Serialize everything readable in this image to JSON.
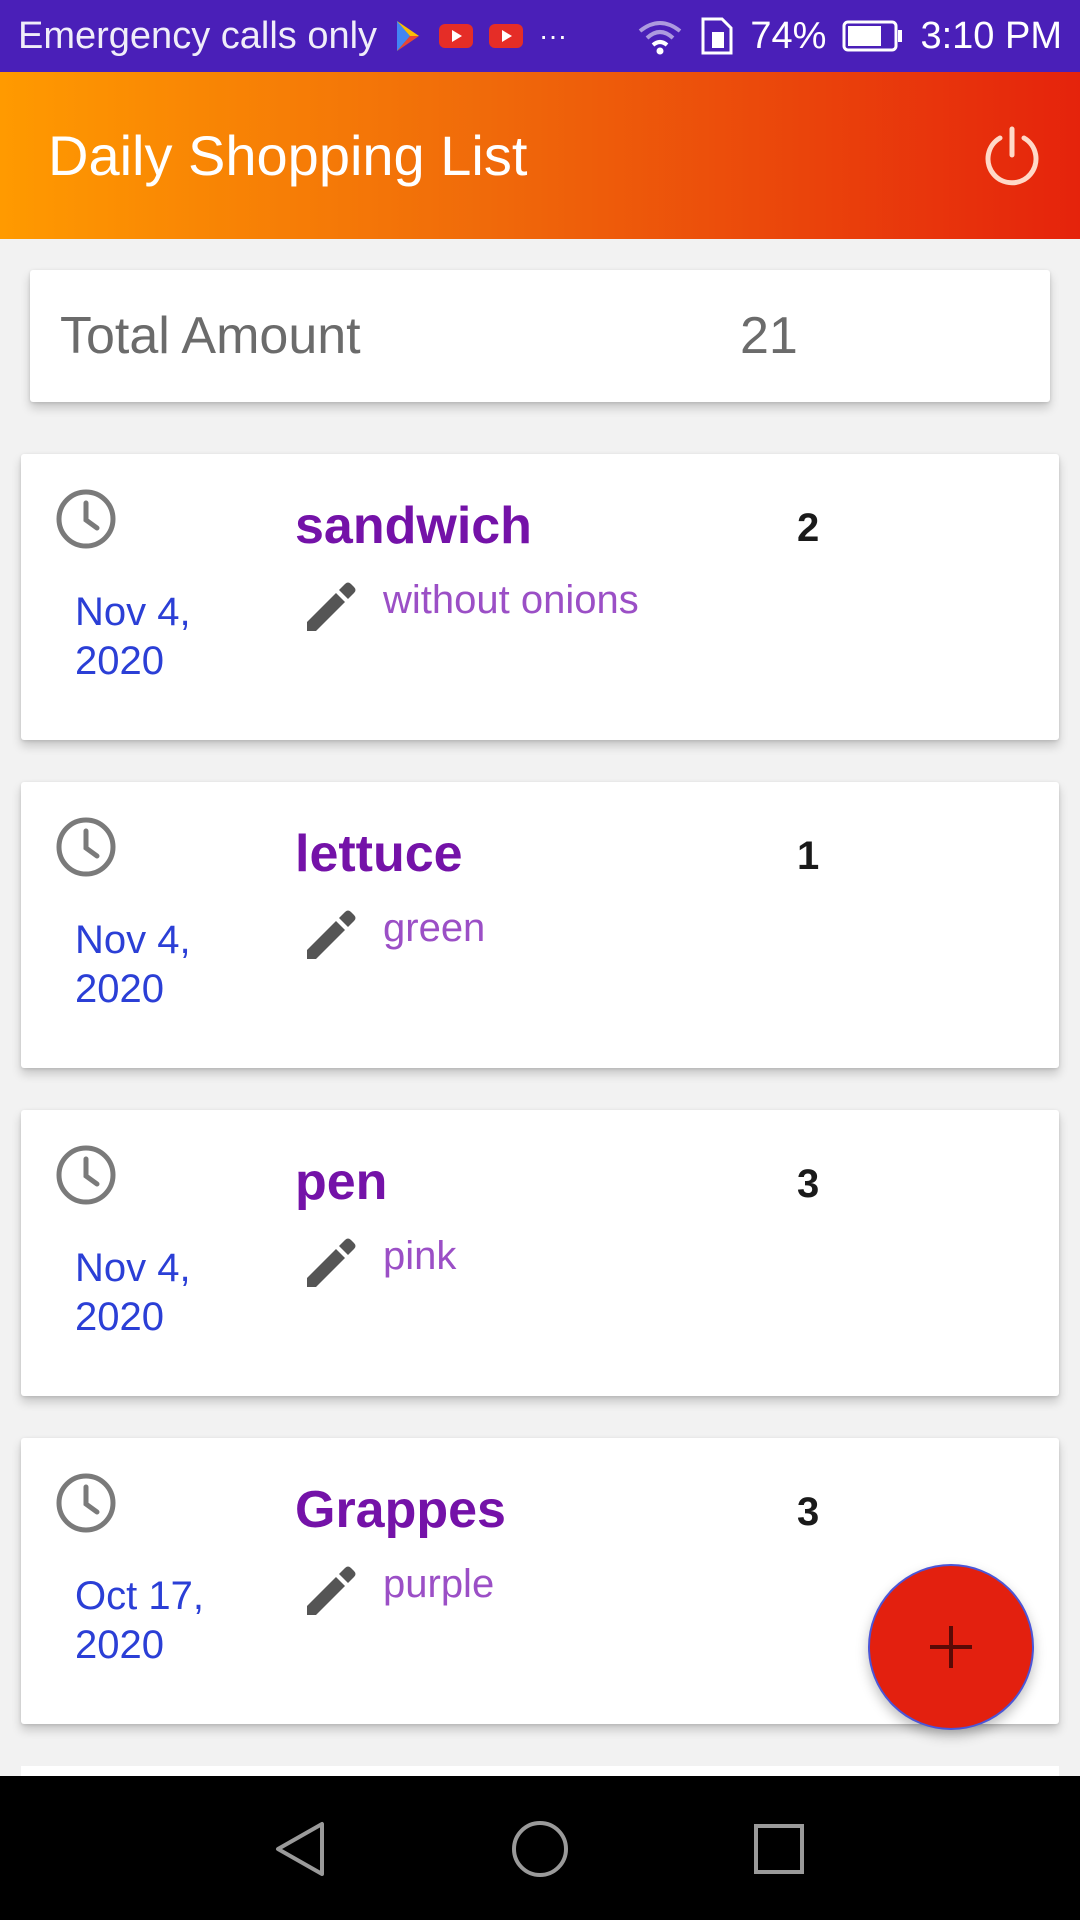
{
  "status_bar": {
    "carrier_text": "Emergency calls only",
    "icons": [
      "games-icon",
      "youtube-icon",
      "youtube-icon",
      "more-dots-icon",
      "wifi-icon",
      "sim-icon",
      "battery-icon"
    ],
    "overflow_text": "···",
    "battery_percent": "74%",
    "battery_level": 0.74,
    "time": "3:10 PM"
  },
  "app_bar": {
    "title": "Daily Shopping List",
    "action_icon": "power-icon",
    "gradient_colors": [
      "#ff9a00",
      "#f06a0a",
      "#e5230c"
    ]
  },
  "total": {
    "label": "Total Amount",
    "value": "21"
  },
  "items": [
    {
      "name": "sandwich",
      "note": "without onions",
      "qty": "2",
      "date_line1": "Nov 4,",
      "date_line2": "2020"
    },
    {
      "name": "lettuce",
      "note": "green",
      "qty": "1",
      "date_line1": "Nov 4,",
      "date_line2": "2020"
    },
    {
      "name": "pen",
      "note": "pink",
      "qty": "3",
      "date_line1": "Nov 4,",
      "date_line2": "2020"
    },
    {
      "name": "Grappes",
      "note": "purple",
      "qty": "3",
      "date_line1": "Oct 17,",
      "date_line2": "2020"
    }
  ],
  "colors": {
    "item_name": "#7412a8",
    "item_note": "#9b4fc6",
    "date": "#2b3fd6",
    "fab": "#e3200f",
    "status_bar": "#4a1fb8"
  },
  "fab": {
    "icon": "plus-icon"
  },
  "nav_bar": {
    "icons": [
      "back-icon",
      "home-icon",
      "recents-icon"
    ]
  }
}
